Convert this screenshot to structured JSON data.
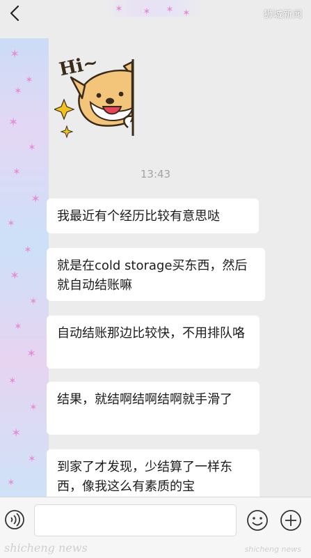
{
  "header": {
    "back_icon": "chevron-left-icon",
    "more_icon": "more-dots-icon",
    "watermark": "狮城新闻"
  },
  "sticker": {
    "text": "Hi~",
    "description_icon": "dog-waving-sticker"
  },
  "chat": {
    "timestamp": "13:43",
    "messages": [
      "我最近有个经历比较有意思哒",
      "就是在cold storage买东西，然后就自动结账嘛",
      "自动结账那边比较快，不用排队咯",
      "结果，就结啊结啊结啊就手滑了",
      "到家了才发现，少结算了一样东西，像我这么有素质的宝"
    ]
  },
  "input_bar": {
    "voice_icon": "voice-icon",
    "emoji_icon": "emoji-icon",
    "plus_icon": "plus-icon",
    "watermark_left": "shicheng news",
    "watermark_right": "shicheng news"
  },
  "colors": {
    "background": "#ececec",
    "bubble": "#ffffff",
    "timestamp": "#a3a3a3",
    "sticker_dog": "#f3c57a",
    "star_pink": "#e58fd6"
  }
}
